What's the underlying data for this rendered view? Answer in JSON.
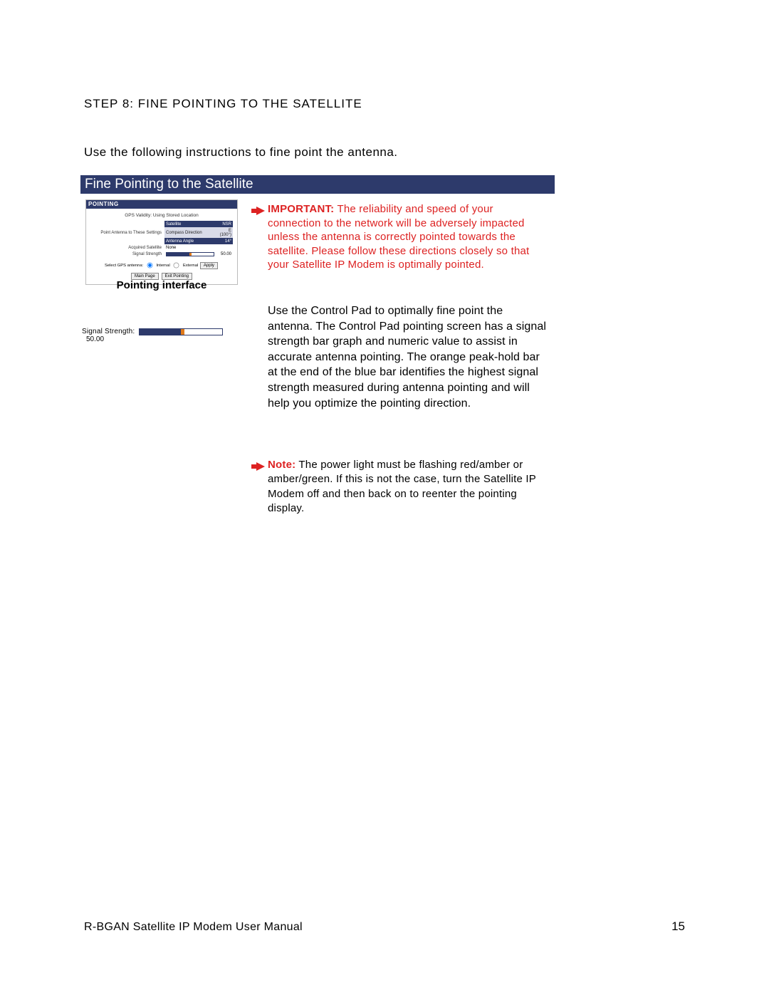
{
  "heading": "STEP 8:  FINE POINTING TO THE SATELLITE",
  "intro": "Use the following instructions to fine point the antenna.",
  "banner": "Fine Pointing to the Satellite",
  "panel": {
    "title": "POINTING",
    "gps_line": "GPS Validity: Using Stored Location",
    "rows": {
      "sat_label": "Satellite",
      "sat_val": "NSR",
      "params_label": "Point Antenna to These Settings",
      "compass_label": "Compass Direction",
      "compass_val": "E (100°)",
      "angle_label": "Antenna Angle",
      "angle_val": "14°",
      "acquired_label": "Acquired Satellite",
      "acquired_val": "None",
      "sig_label": "Signal Strength",
      "sig_val": "50.00"
    },
    "radio_line_prefix": "Select GPS antenna:",
    "radio_internal": "Internal",
    "radio_external": "External",
    "apply_btn": "Apply",
    "btn_main": "Main Page",
    "btn_exit": "Exit Pointing",
    "caption": "Pointing interface"
  },
  "sig": {
    "label": "Signal Strength:",
    "value": "50.00"
  },
  "important": {
    "lead": "IMPORTANT:",
    "body": "  The reliability and speed of your connection to the network will be adversely impacted unless the antenna is correctly pointed towards the satellite.  Please follow these directions closely so that your Satellite IP Modem is optimally pointed."
  },
  "para": "Use the Control Pad to optimally fine point the antenna.  The Control Pad pointing screen has a signal strength bar graph and numeric value to assist in accurate antenna pointing.  The orange peak-hold bar at the end of the blue bar identifies the highest signal strength measured during antenna pointing and will help you optimize the pointing direction.",
  "note": {
    "lead": "Note:",
    "body": "  The power light must be flashing red/amber or amber/green.  If this is not the case, turn the Satellite IP Modem off and then back on to reenter the pointing display."
  },
  "footer": {
    "left": "R-BGAN Satellite IP Modem User Manual",
    "page": "15"
  }
}
